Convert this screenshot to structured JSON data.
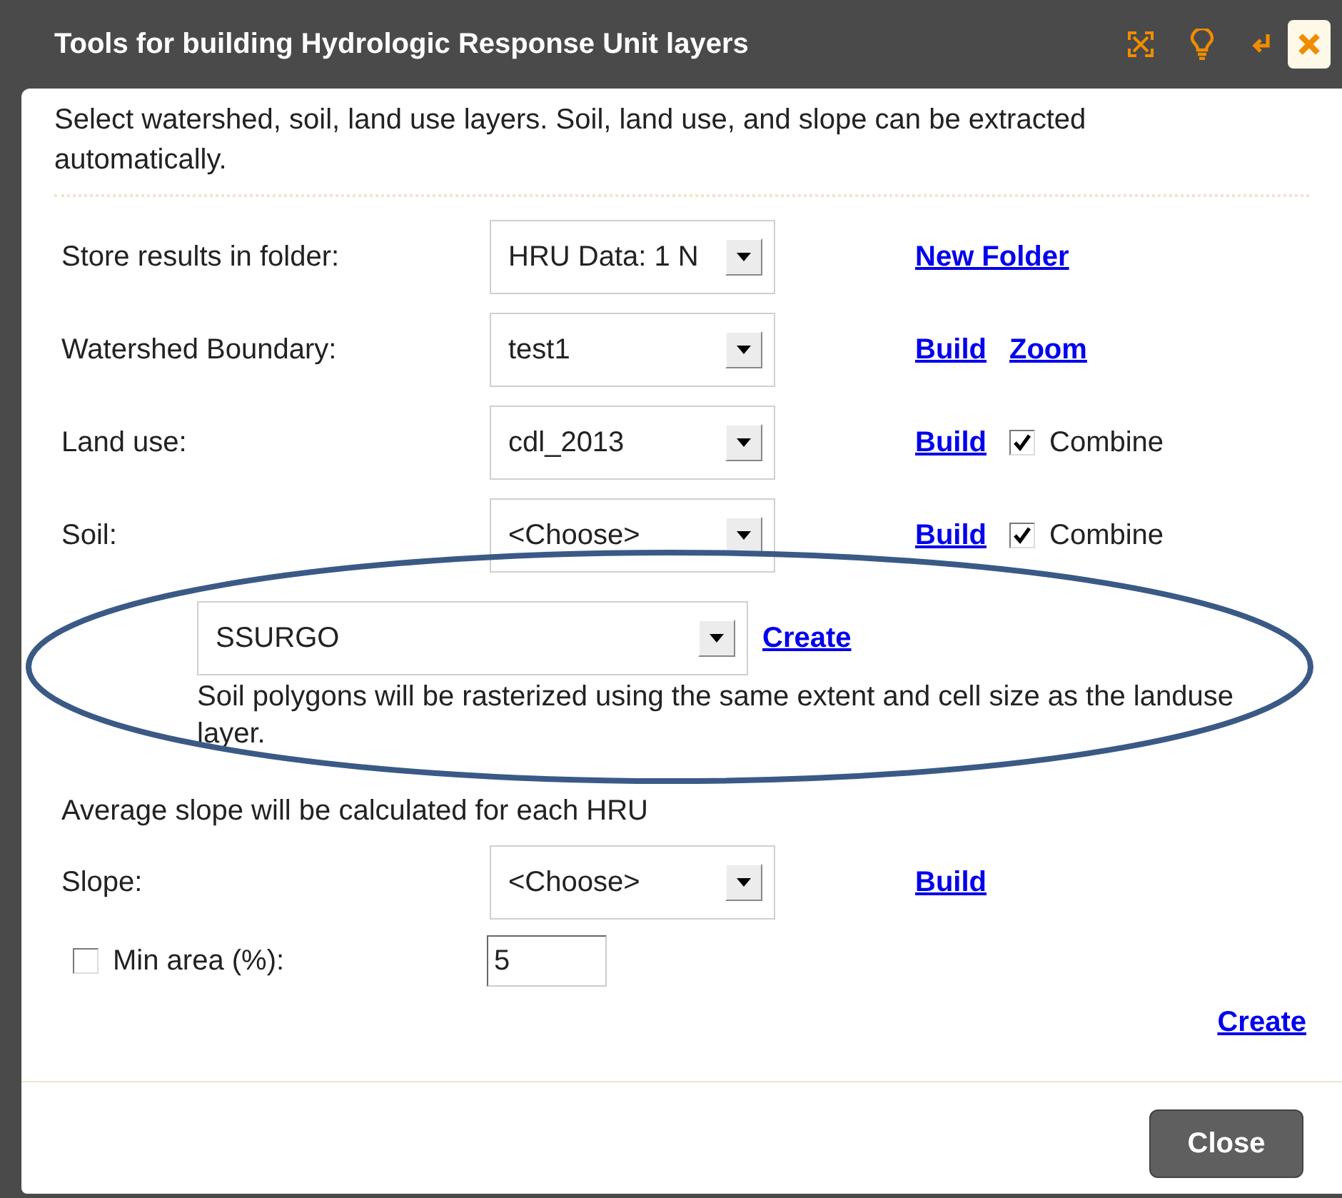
{
  "window": {
    "title": "Tools for building Hydrologic Response Unit layers"
  },
  "intro": "Select watershed, soil, land use layers. Soil, land use, and slope can be extracted automatically.",
  "rows": [
    {
      "label": "Store results in folder:",
      "value": "HRU Data: 1 N",
      "links": [
        "New Folder"
      ]
    },
    {
      "label": "Watershed Boundary:",
      "value": "test1",
      "links": [
        "Build",
        "Zoom"
      ]
    },
    {
      "label": "Land use:",
      "value": "cdl_2013",
      "links": [
        "Build"
      ],
      "combine": {
        "label": "Combine",
        "checked": true
      }
    },
    {
      "label": "Soil:",
      "value": "<Choose>",
      "links": [
        "Build"
      ],
      "combine": {
        "label": "Combine",
        "checked": true
      }
    }
  ],
  "soil_source": {
    "value": "SSURGO",
    "link": "Create",
    "note": "Soil polygons will be rasterized using the same extent and cell size as the landuse layer."
  },
  "slope_note": "Average slope will be calculated for each HRU",
  "slope": {
    "label": "Slope:",
    "value": "<Choose>",
    "links": [
      "Build"
    ]
  },
  "min_area": {
    "label": "Min area (%):",
    "checked": false,
    "value": "5"
  },
  "create_link": "Create",
  "close_button": "Close"
}
